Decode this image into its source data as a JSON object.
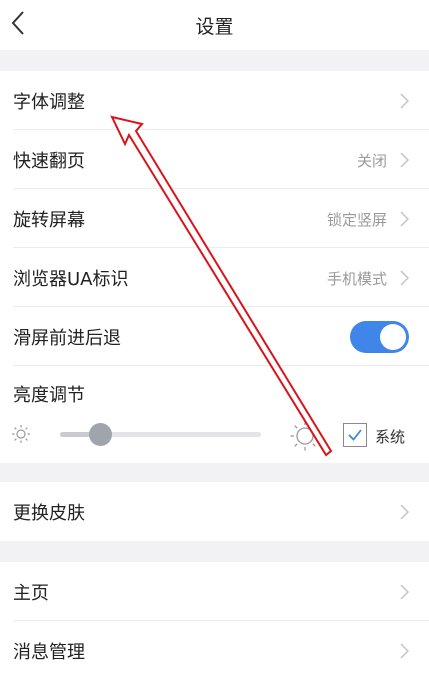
{
  "header": {
    "title": "设置"
  },
  "group1": {
    "font": {
      "label": "字体调整"
    },
    "page_turn": {
      "label": "快速翻页",
      "value": "关闭"
    },
    "rotate": {
      "label": "旋转屏幕",
      "value": "锁定竖屏"
    },
    "ua": {
      "label": "浏览器UA标识",
      "value": "手机模式"
    },
    "swipe": {
      "label": "滑屏前进后退",
      "toggle_on": true
    },
    "brightness": {
      "label": "亮度调节",
      "level": 0.2,
      "system_checked": true,
      "system_label": "系统"
    }
  },
  "group2": {
    "skin": {
      "label": "更换皮肤"
    }
  },
  "group3": {
    "home": {
      "label": "主页"
    },
    "messages": {
      "label": "消息管理"
    }
  },
  "colors": {
    "accent": "#3f86e8",
    "annotation": "#d9141b"
  },
  "icons": [
    "back-chevron-icon",
    "chevron-right-icon",
    "sun-small-icon",
    "sun-large-icon",
    "checkmark-icon"
  ]
}
